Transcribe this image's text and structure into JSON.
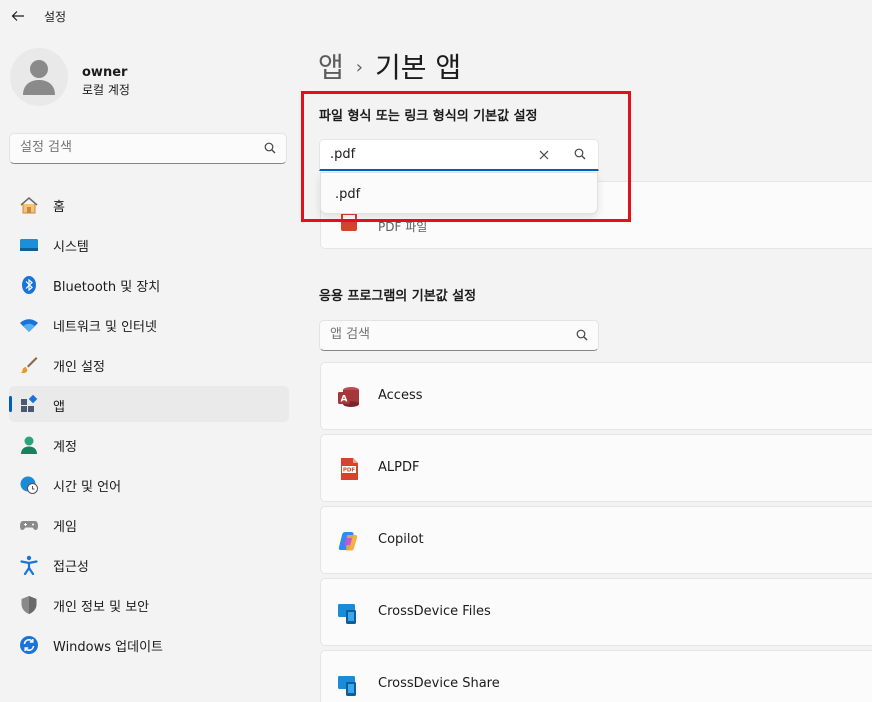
{
  "window": {
    "title": "설정"
  },
  "profile": {
    "name": "owner",
    "account_type": "로컬 계정"
  },
  "sidebar": {
    "search_placeholder": "설정 검색",
    "items": [
      {
        "label": "홈",
        "icon": "home-icon",
        "active": false
      },
      {
        "label": "시스템",
        "icon": "system-icon",
        "active": false
      },
      {
        "label": "Bluetooth 및 장치",
        "icon": "bluetooth-icon",
        "active": false
      },
      {
        "label": "네트워크 및 인터넷",
        "icon": "wifi-icon",
        "active": false
      },
      {
        "label": "개인 설정",
        "icon": "brush-icon",
        "active": false
      },
      {
        "label": "앱",
        "icon": "apps-icon",
        "active": true
      },
      {
        "label": "계정",
        "icon": "account-icon",
        "active": false
      },
      {
        "label": "시간 및 언어",
        "icon": "globe-clock-icon",
        "active": false
      },
      {
        "label": "게임",
        "icon": "gamepad-icon",
        "active": false
      },
      {
        "label": "접근성",
        "icon": "accessibility-icon",
        "active": false
      },
      {
        "label": "개인 정보 및 보안",
        "icon": "shield-icon",
        "active": false
      },
      {
        "label": "Windows 업데이트",
        "icon": "update-icon",
        "active": false
      }
    ]
  },
  "breadcrumb": {
    "parent": "앱",
    "separator": "›",
    "current": "기본 앱"
  },
  "file_type_section": {
    "title": "파일 형식 또는 링크 형식의 기본값 설정",
    "search_value": ".pdf",
    "suggestion": ".pdf",
    "result": {
      "label": "PDF 파일",
      "icon": "pdf-file-icon"
    }
  },
  "apps_section": {
    "title": "응용 프로그램의 기본값 설정",
    "search_placeholder": "앱 검색",
    "apps": [
      {
        "name": "Access",
        "icon": "access-icon"
      },
      {
        "name": "ALPDF",
        "icon": "alpdf-icon"
      },
      {
        "name": "Copilot",
        "icon": "copilot-icon"
      },
      {
        "name": "CrossDevice Files",
        "icon": "crossdevice-icon"
      },
      {
        "name": "CrossDevice Share",
        "icon": "crossdevice-icon"
      }
    ]
  },
  "colors": {
    "accent": "#005fb8",
    "highlight_box": "#e3101a"
  }
}
